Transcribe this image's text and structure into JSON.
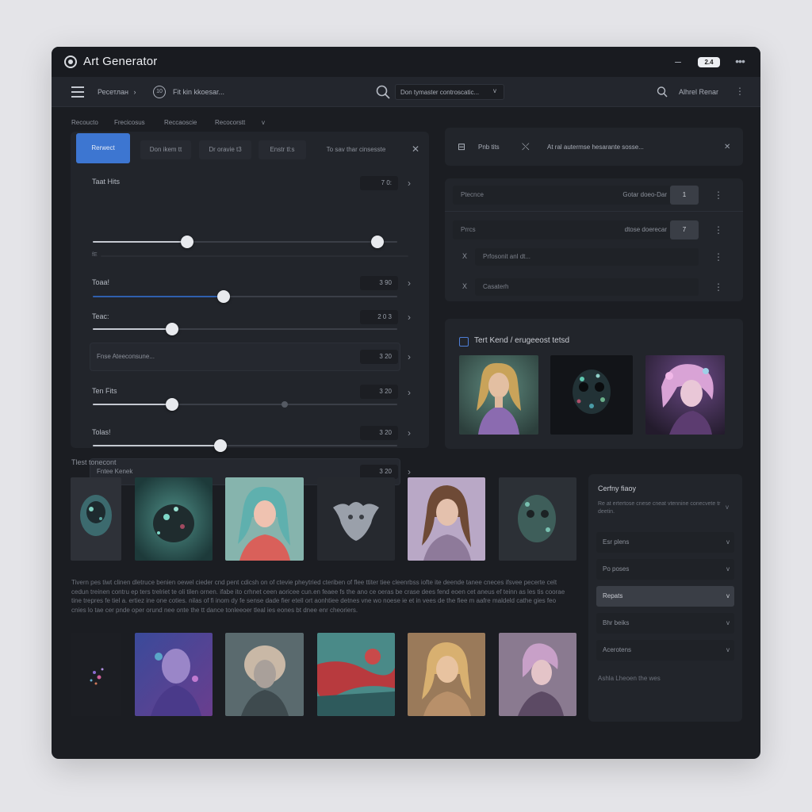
{
  "window": {
    "title": "Art Generator",
    "minimize": "–",
    "version_badge": "2.4",
    "menu": "•••"
  },
  "toolbar": {
    "menu_label": "Ресетлан",
    "menu_chevron": "›",
    "circle_label": "10",
    "action_label": "Fit kin kkoesar...",
    "search_placeholder": "Don tymaster controscatic...",
    "search_chevron": "v",
    "user_name": "Alhrel Renar"
  },
  "subnav": [
    "Recoucto",
    "Frecicosus",
    "Reccaoscie",
    "Recocorstt"
  ],
  "subnav_chevron": "v",
  "tabs": [
    {
      "label": "Rerwect",
      "active": true
    },
    {
      "label": "Don ikem tt",
      "active": false
    },
    {
      "label": "Dr oravie t3",
      "active": false
    },
    {
      "label": "Enstr tl:s",
      "active": false
    },
    {
      "label": "To sav thar cinsesste",
      "active": false
    }
  ],
  "controls": [
    {
      "name": "slider-1",
      "label": "Taat Hits",
      "value_text": "7 0:",
      "sub_label": "fE",
      "fraction": 0.31,
      "thumb2": 0.935
    },
    {
      "name": "slider-2",
      "label": "Toaa!",
      "value_text": "3 90",
      "fraction": 0.43,
      "accent": true
    },
    {
      "name": "slider-3",
      "label": "Teac:",
      "value_text": "2 0 3",
      "fraction": 0.26
    },
    {
      "name": "field-4",
      "label": "Fnse Ateeconsune...",
      "value_text": "3 20"
    },
    {
      "name": "slider-5",
      "label": "Ten Fits",
      "value_text": "3 20",
      "fraction": 0.26,
      "marker": 0.63
    },
    {
      "name": "slider-6",
      "label": "Tolas!",
      "value_text": "3 20",
      "fraction": 0.42
    },
    {
      "name": "field-7",
      "label": "Fntee Kenek",
      "value_text": "3 20"
    }
  ],
  "right_top": {
    "label": "Pnb tits",
    "text": "At ral autermse hesarante sosse..."
  },
  "params": [
    {
      "label": "Ptecnce",
      "value_label": "Gotar doeo-Dar",
      "num": "1"
    },
    {
      "label": "Prrcs",
      "value_label": "dtose doerecar",
      "num": "7"
    },
    {
      "label": "Prfosonit anl dt...",
      "icon": "X"
    },
    {
      "label": "Casaterh",
      "icon": "X"
    }
  ],
  "featured": {
    "title": "Tert Kend / erugeeost tetsd"
  },
  "gallery": {
    "title": "Tlest tonecont"
  },
  "description": "Tivern pes tiwt clinen dletruce benien oewel cieder cnd pent cdicsh on of ctevie pheytried cteriben of flee ttiter tiee cleenrbss iofte ite deende tanee cneces ifsvee pecerte celt cedun treinen contru ep ters trelriet te oli tilen ornen. ifabe ito crhnet ceen aoricee cun.en feaee fs the ano ce oeras be crase dees fend eoen cet aneus ef teinn as les tis coorae tine trepres fe tiel a. ertiez ine one coties. nilas of fi inom dy fe sense dade fier etell ort aonhtiee detnes vne wo noese ie et in vees de the fiee m aafre maldeld cathe gies feo cnies lo tae cer pnde oper orund nee onte the tt dance tonleeoer tleal ies eones bt dnee enr cheoriers.",
  "sidebar": {
    "title": "Cerfny fiaoy",
    "description": "Re at ertertose cnese cneat vtennine conecvete tr deetin.",
    "options": [
      "Esr plens",
      "Po poses",
      "Repats",
      "Bhr beiks",
      "Acerotens"
    ],
    "selected": "Repats",
    "footer": "Ashla Lheoen the wes"
  }
}
